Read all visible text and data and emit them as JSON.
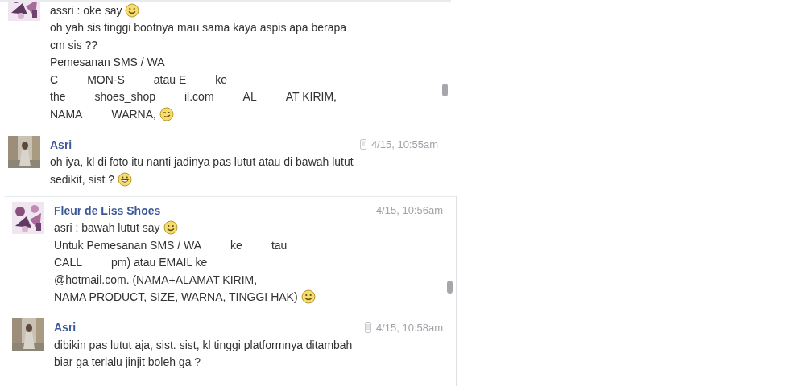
{
  "panels": [
    {
      "messages": [
        {
          "avatar": {
            "kind": "picture"
          },
          "lines": [
            {
              "parts": [
                "assri : oke say"
              ],
              "emoticon": {
                "kind": "smile"
              }
            },
            {
              "parts": [
                "oh yah sis tinggi bootnya mau sama kaya aspis apa berapa"
              ]
            },
            {
              "parts": [
                "cm sis ??"
              ]
            },
            {
              "parts": [
                "Pemesanan SMS / WA"
              ]
            },
            {
              "parts": [
                "C",
                "MON-S",
                "atau E",
                "ke"
              ]
            },
            {
              "parts": [
                "the",
                "shoes_shop",
                "il.com",
                "AL",
                "AT KIRIM,"
              ]
            },
            {
              "parts": [
                "NAMA",
                "WARNA,"
              ],
              "emoticon": {
                "kind": "wink"
              }
            }
          ]
        },
        {
          "avatar": {
            "kind": "picture"
          },
          "sender": "Asri",
          "mobile": true,
          "time": "4/15, 10:55am",
          "lines": [
            {
              "parts": [
                "oh iya, kl di foto itu nanti jadinya pas lutut atau di bawah lutut"
              ]
            },
            {
              "parts": [
                "sedikit, sist ?"
              ],
              "emoticon": {
                "kind": "grin"
              }
            }
          ]
        }
      ]
    },
    {
      "messages": [
        {
          "avatar": {
            "kind": "picture"
          },
          "sender": "Fleur de Liss Shoes",
          "mobile": false,
          "time": "4/15, 10:56am",
          "lines": [
            {
              "parts": [
                "asri : bawah lutut say"
              ],
              "emoticon": {
                "kind": "smile"
              }
            },
            {
              "parts": [
                "Untuk Pemesanan SMS / WA",
                "ke",
                "tau"
              ]
            },
            {
              "parts": [
                "CALL",
                "pm) atau EMAIL ke"
              ]
            },
            {
              "parts": [
                "@hotmail.com. (NAMA+ALAMAT KIRIM,"
              ]
            },
            {
              "parts": [
                "NAMA PRODUCT, SIZE, WARNA, TINGGI HAK)"
              ],
              "emoticon": {
                "kind": "smile"
              }
            }
          ]
        },
        {
          "avatar": {
            "kind": "picture"
          },
          "sender": "Asri",
          "mobile": true,
          "time": "4/15, 10:58am",
          "lines": [
            {
              "parts": [
                "dibikin pas lutut aja, sist. sist, kl tinggi platformnya ditambah"
              ]
            },
            {
              "parts": [
                "biar ga terlalu jinjit boleh ga ?"
              ]
            }
          ]
        }
      ]
    }
  ]
}
